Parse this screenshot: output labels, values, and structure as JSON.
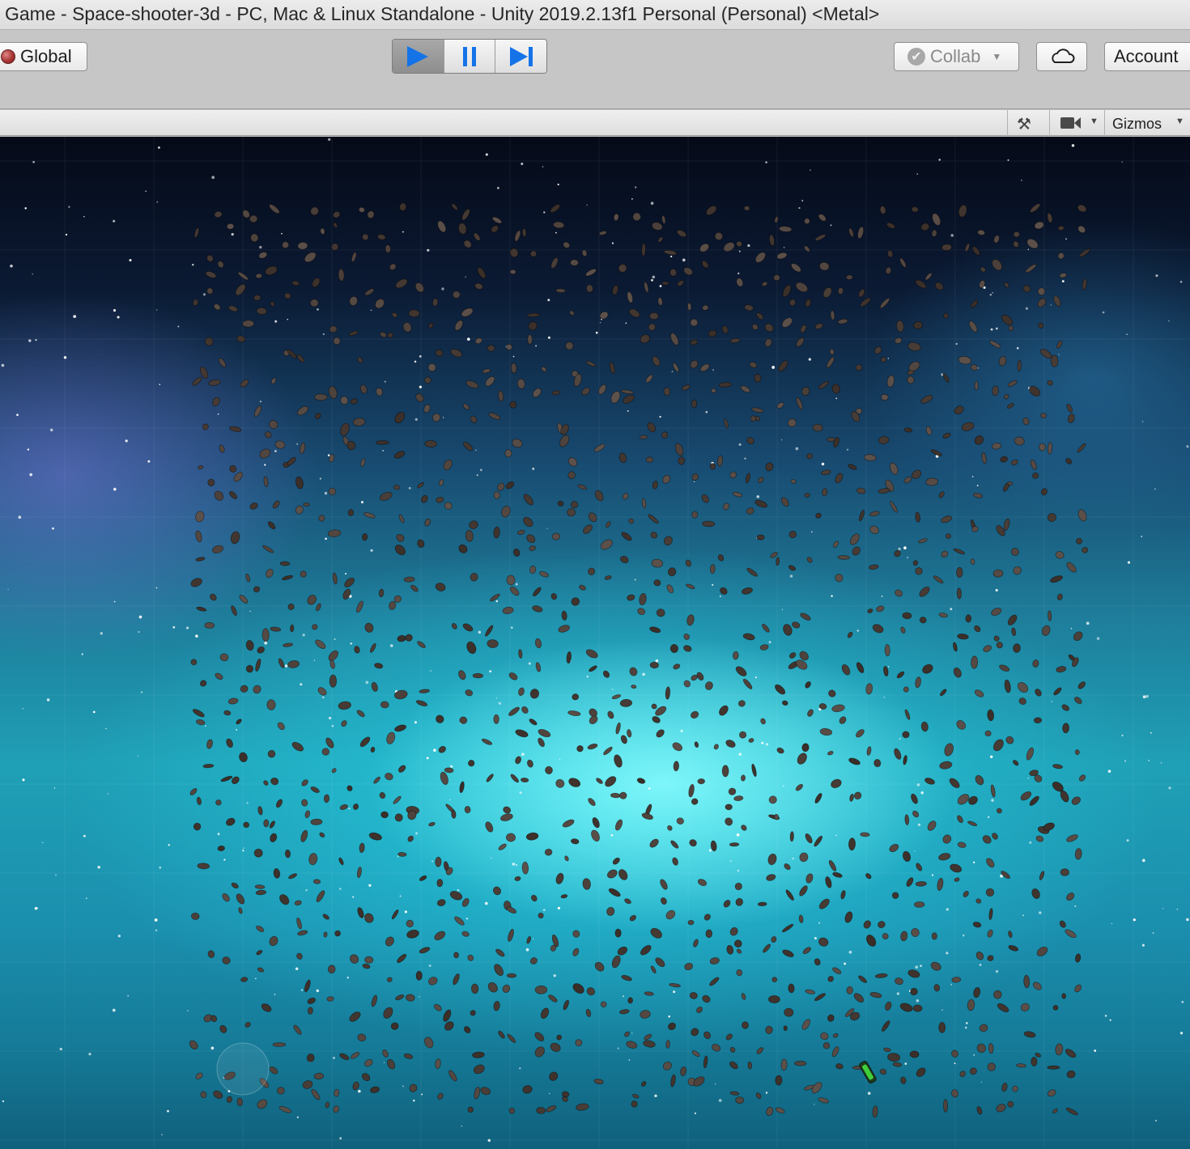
{
  "window": {
    "title": "Game - Space-shooter-3d - PC, Mac & Linux Standalone - Unity 2019.2.13f1 Personal (Personal) <Metal>"
  },
  "toolbar": {
    "global_label": "Global",
    "collab_label": "Collab",
    "account_label": "Account",
    "play_state": "playing"
  },
  "game_view": {
    "gizmos_label": "Gizmos"
  },
  "icons": {
    "globe": "globe-icon",
    "play": "play-icon",
    "pause": "pause-icon",
    "step": "step-icon",
    "collab_check": "check-icon",
    "cloud": "cloud-icon",
    "tools": "tools-icon",
    "camera": "camera-icon"
  },
  "colors": {
    "play_accent": "#1573e8",
    "asteroid": "#4a3b32",
    "ship": "#3ecf3a"
  }
}
